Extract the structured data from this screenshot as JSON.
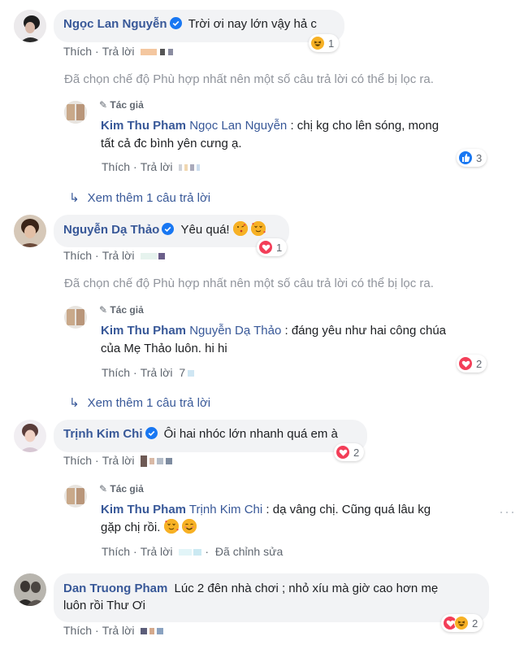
{
  "labels": {
    "like": "Thích",
    "reply": "Trả lời",
    "author_tag": "Tác giả",
    "filter_note": "Đã chọn chế độ Phù hợp nhất nên một số câu trả lời có thể bị lọc ra.",
    "view_more": "Xem thêm 1 câu trả lời",
    "edited": "Đã chỉnh sửa",
    "dot": "·"
  },
  "comments": [
    {
      "author": "Ngọc Lan Nguyễn",
      "text": "Trời ơi nay lớn vậy hả c",
      "reaction_count": "1",
      "reply": {
        "author": "Kim Thu Pham",
        "mention": "Ngọc Lan Nguyễn",
        "text_line1": ": chị kg cho lên sóng, mong",
        "text_line2": "tất cả đc bình yên cưng ạ.",
        "reaction_count": "3"
      }
    },
    {
      "author": "Nguyễn Dạ Thảo",
      "text": "Yêu quá!",
      "reaction_count": "1",
      "reply": {
        "author": "Kim Thu Pham",
        "mention": "Nguyễn Dạ Thảo",
        "text_line1": ": đáng yêu như hai công chúa",
        "text_line2": "của Mẹ Thảo luôn. hi hi",
        "reaction_count": "2",
        "time": "7"
      }
    },
    {
      "author": "Trịnh Kim Chi",
      "text": "Ôi hai nhóc lớn nhanh quá em à",
      "reaction_count": "2",
      "reply": {
        "author": "Kim Thu Pham",
        "mention": "Trịnh Kim Chi",
        "text_line1": ": dạ vâng chị. Cũng quá lâu kg",
        "text_line2": "gặp chị rồi."
      }
    },
    {
      "author": "Dan Truong Pham",
      "text_line1": "Lúc 2 đên nhà chơi ; nhỏ xíu mà giờ cao hơn mẹ",
      "text_line2": "luôn rồi Thư Ơi",
      "reaction_count": "2"
    }
  ],
  "colors": {
    "link": "#385898",
    "verified": "#1877f2",
    "love": "#f33e58",
    "like": "#1877f2",
    "haha": "#f7b125"
  }
}
